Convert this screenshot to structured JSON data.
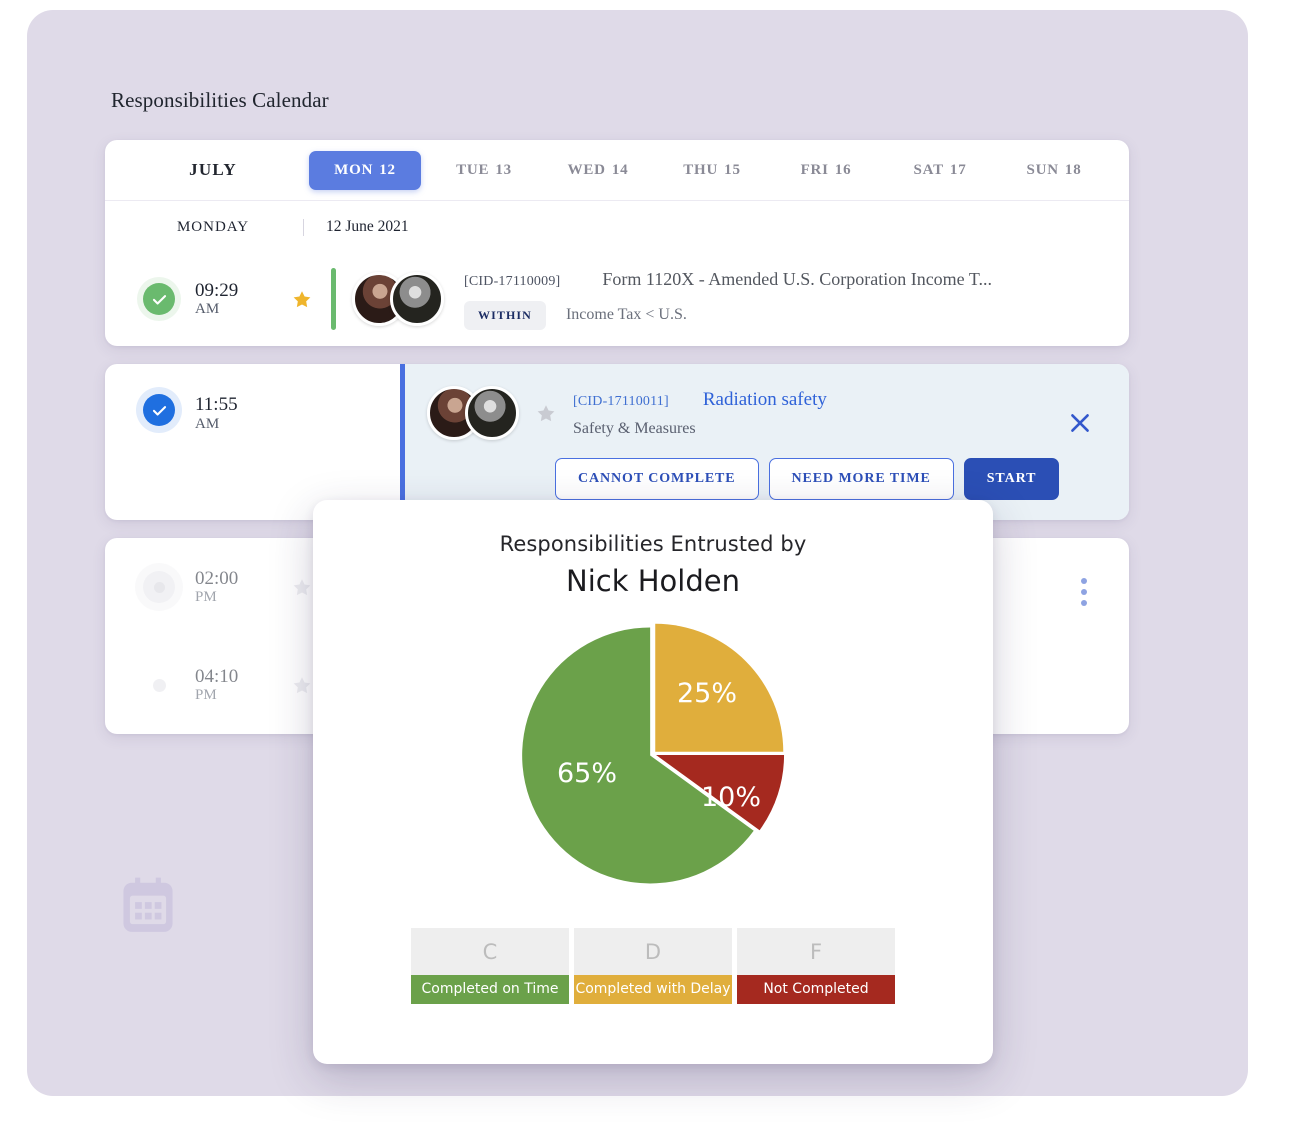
{
  "page": {
    "title": "Responsibilities Calendar",
    "watermark_icon": "calendar-icon"
  },
  "calendar": {
    "month": "JULY",
    "days": [
      {
        "name": "MON",
        "num": "12",
        "active": true
      },
      {
        "name": "TUE",
        "num": "13",
        "active": false
      },
      {
        "name": "WED",
        "num": "14",
        "active": false
      },
      {
        "name": "THU",
        "num": "15",
        "active": false
      },
      {
        "name": "FRI",
        "num": "16",
        "active": false
      },
      {
        "name": "SAT",
        "num": "17",
        "active": false
      },
      {
        "name": "SUN",
        "num": "18",
        "active": false
      }
    ],
    "selected_day_of_week": "MONDAY",
    "selected_date": "12 June 2021"
  },
  "tasks": [
    {
      "time": "09:29",
      "meridiem": "AM",
      "status": "completed",
      "starred": true,
      "cid": "[CID-17110009]",
      "title": "Form 1120X - Amended U.S. Corporation Income T...",
      "badge": "WITHIN",
      "subtitle": "Income Tax < U.S."
    },
    {
      "time": "11:55",
      "meridiem": "AM",
      "status": "active",
      "starred": false,
      "cid": "[CID-17110011]",
      "title": "Radiation safety",
      "subtitle": "Safety & Measures",
      "actions": {
        "cannot_complete": "CANNOT COMPLETE",
        "need_more_time": "NEED MORE TIME",
        "start": "START"
      },
      "close_label": "close-icon"
    },
    {
      "time": "02:00",
      "meridiem": "PM",
      "status": "pending",
      "starred": false
    },
    {
      "time": "04:10",
      "meridiem": "PM",
      "status": "pending",
      "starred": false
    }
  ],
  "modal": {
    "subtitle": "Responsibilities Entrusted by",
    "name": "Nick Holden",
    "legend": [
      {
        "letter": "C",
        "label": "Completed on Time",
        "color": "#6ba14a"
      },
      {
        "letter": "D",
        "label": "Completed with Delay",
        "color": "#e0ae3c"
      },
      {
        "letter": "F",
        "label": "Not Completed",
        "color": "#a5291f"
      }
    ]
  },
  "chart_data": {
    "type": "pie",
    "title": "Responsibilities Entrusted by Nick Holden",
    "categories": [
      "Completed on Time",
      "Completed with Delay",
      "Not Completed"
    ],
    "values": [
      65,
      25,
      10
    ],
    "labels": [
      "65%",
      "25%",
      "10%"
    ],
    "colors": [
      "#6ba14a",
      "#e0ae3c",
      "#a5291f"
    ],
    "legend_position": "bottom",
    "units": "percent"
  },
  "colors": {
    "panel_bg": "#dfdae8",
    "accent_blue": "#5b7ce0",
    "primary_blue": "#2b4fb5",
    "status_green": "#6aba6e",
    "status_blue": "#1f6fe0",
    "star_gold": "#efb52c",
    "selected_row_bg": "#eaf1f6"
  }
}
